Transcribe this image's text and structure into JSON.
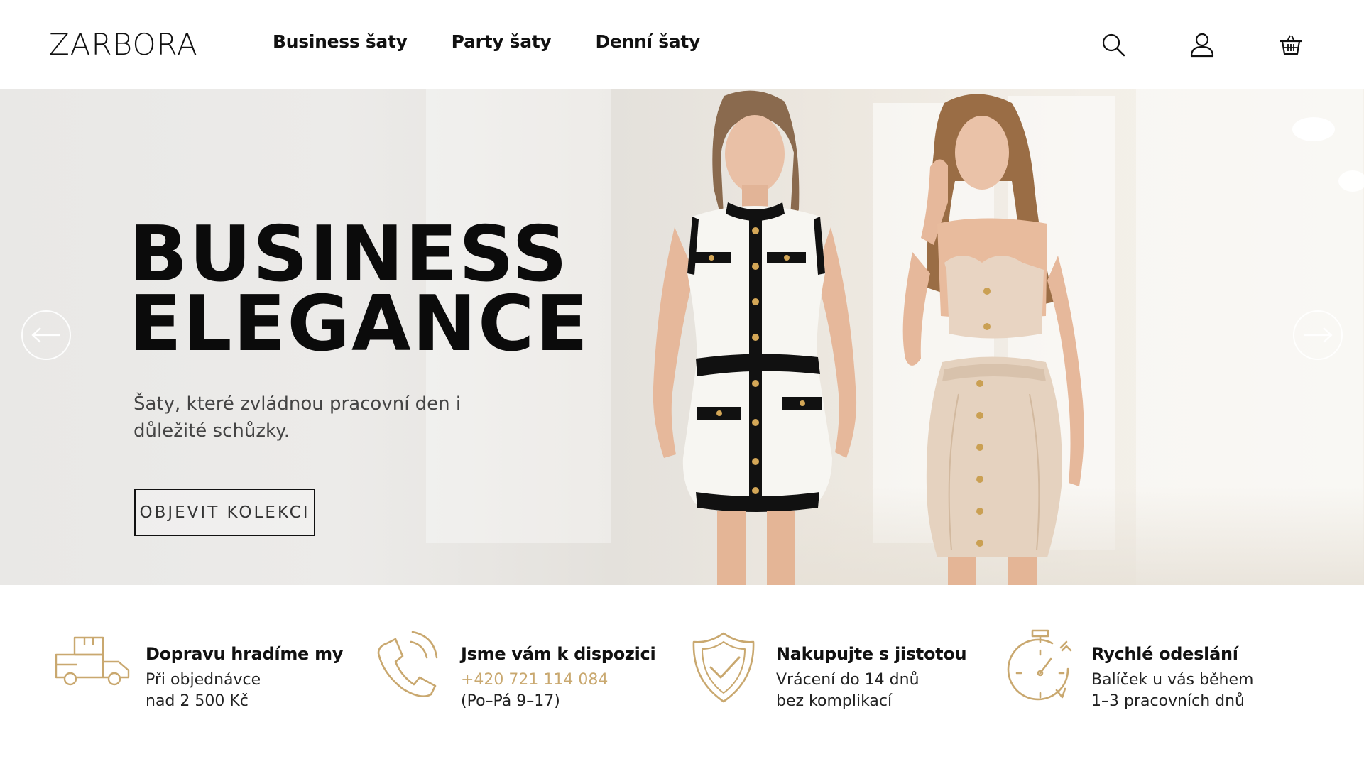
{
  "brand": {
    "logo": "ZARBORA"
  },
  "nav": {
    "items": [
      {
        "label": "Business šaty"
      },
      {
        "label": "Party šaty"
      },
      {
        "label": "Denní šaty"
      }
    ]
  },
  "header_icons": [
    "search-icon",
    "user-icon",
    "basket-icon"
  ],
  "hero": {
    "title_line1": "BUSINESS",
    "title_line2": "ELEGANCE",
    "subtitle": "Šaty, které zvládnou pracovní den i důležité schůzky.",
    "cta_label": "OBJEVIT KOLEKCI"
  },
  "features": [
    {
      "icon": "delivery-truck-icon",
      "title": "Dopravu hradíme my",
      "line1": "Při objednávce",
      "line2": "nad 2 500 Kč"
    },
    {
      "icon": "phone-icon",
      "title": "Jsme vám k dispozici",
      "line1": "+420 721 114 084",
      "line2": "(Po–Pá 9–17)"
    },
    {
      "icon": "shield-check-icon",
      "title": "Nakupujte s jistotou",
      "line1": "Vrácení do 14 dnů",
      "line2": "bez komplikací"
    },
    {
      "icon": "stopwatch-icon",
      "title": "Rychlé odeslání",
      "line1": "Balíček u vás během",
      "line2": "1–3 pracovních dnů"
    }
  ],
  "colors": {
    "accent_gold": "#c9a86f",
    "text_dark": "#111111"
  }
}
